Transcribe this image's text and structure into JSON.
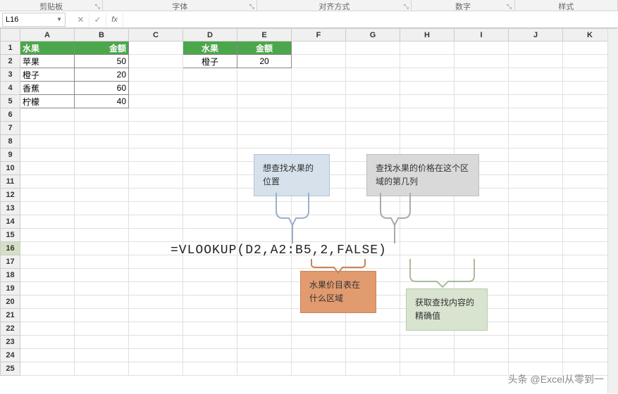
{
  "ribbon_groups": [
    "剪贴板",
    "字体",
    "对齐方式",
    "数字",
    "样式"
  ],
  "name_box_value": "L16",
  "columns": [
    "A",
    "B",
    "C",
    "D",
    "E",
    "F",
    "G",
    "H",
    "I",
    "J",
    "K"
  ],
  "rows_count": 25,
  "table1": {
    "headers": [
      "水果",
      "金额"
    ],
    "rows": [
      [
        "苹果",
        "50"
      ],
      [
        "橙子",
        "20"
      ],
      [
        "香蕉",
        "60"
      ],
      [
        "柠檬",
        "40"
      ]
    ]
  },
  "table2": {
    "headers": [
      "水果",
      "金额"
    ],
    "rows": [
      [
        "橙子",
        "20"
      ]
    ]
  },
  "formula_display": "=VLOOKUP(D2,A2:B5,2,FALSE)",
  "callouts": {
    "arg1": "想查找水果的位置",
    "arg2": "水果价目表在什么区域",
    "arg3": "查找水果的价格在这个区域的第几列",
    "arg4": "获取查找内容的精确值"
  },
  "watermark": "头条 @Excel从零到一"
}
